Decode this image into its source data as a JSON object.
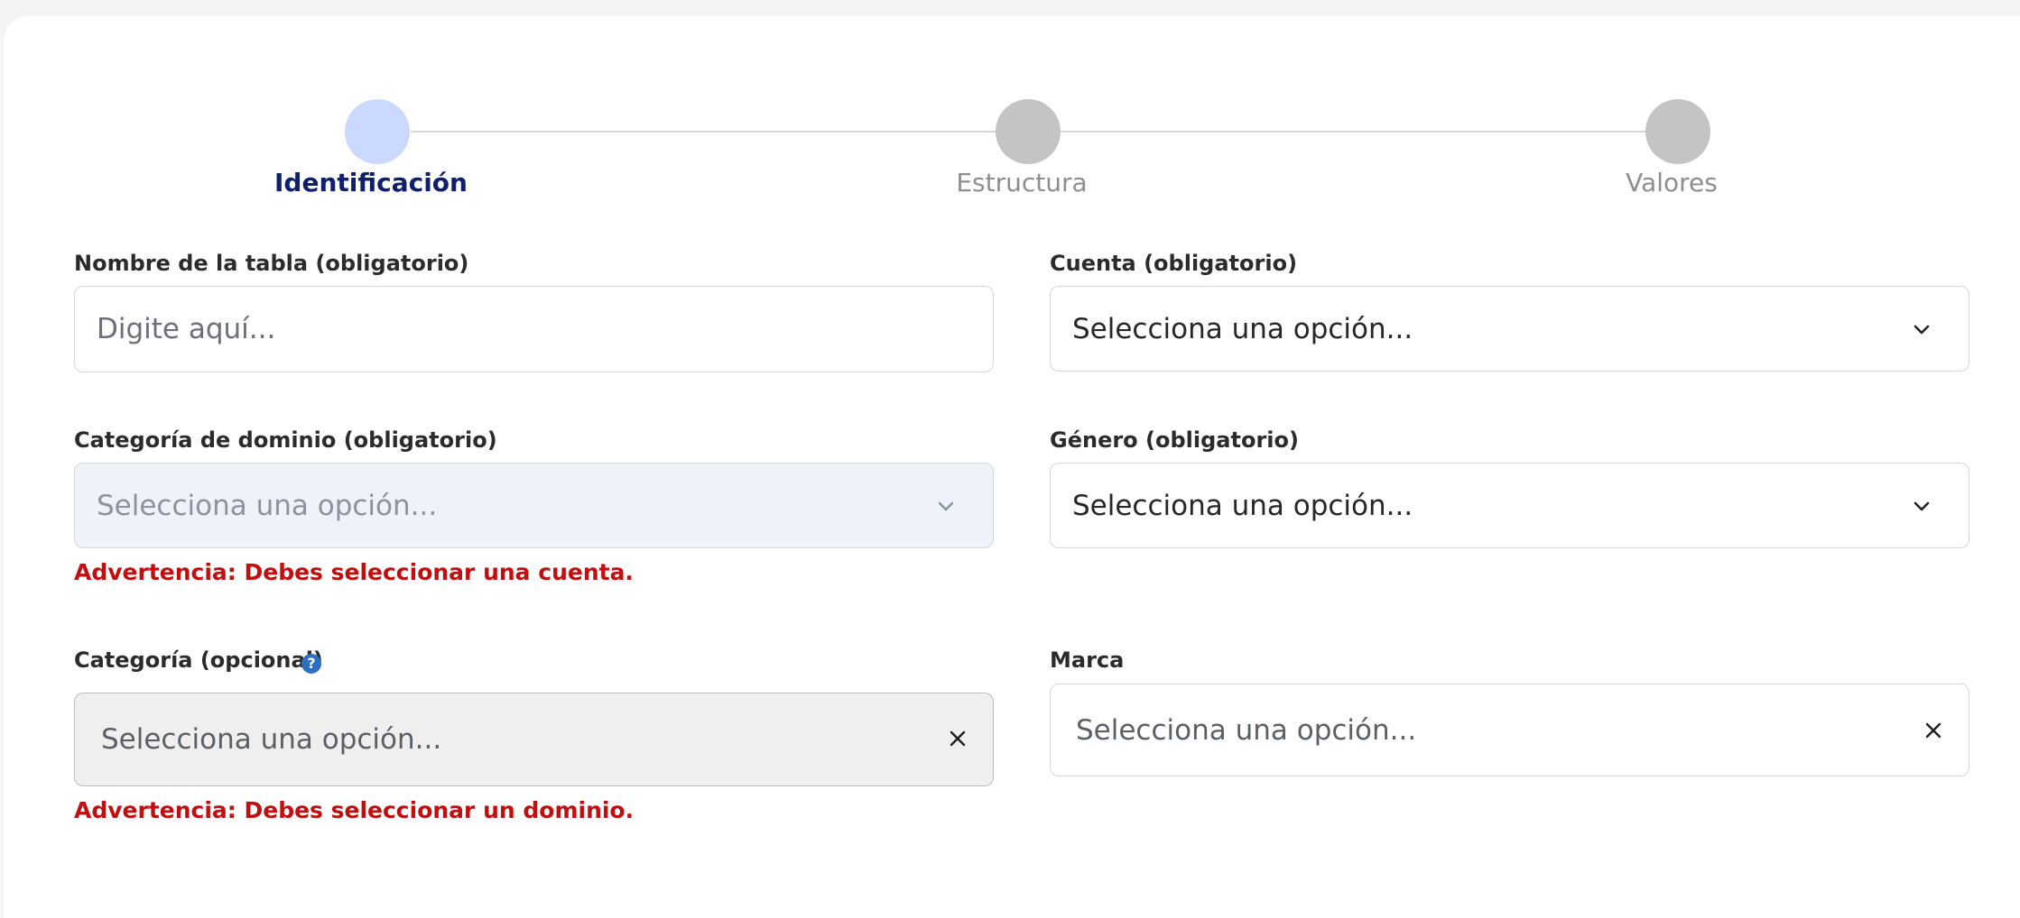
{
  "stepper": {
    "steps": [
      {
        "label": "Identificación",
        "state": "active"
      },
      {
        "label": "Estructura",
        "state": "pending"
      },
      {
        "label": "Valores",
        "state": "pending"
      }
    ],
    "colors": {
      "active_circle": "#ccd9ff",
      "pending_circle": "#c4c4c4",
      "active_label": "#0f1f6b",
      "pending_label": "#8e8e8e"
    }
  },
  "form": {
    "table_name": {
      "label": "Nombre de la tabla (obligatorio)",
      "placeholder": "Digite aquí..."
    },
    "account": {
      "label": "Cuenta (obligatorio)",
      "value": "Selecciona una opción..."
    },
    "domain_category": {
      "label": "Categoría de dominio (obligatorio)",
      "value": "Selecciona una opción...",
      "warning": "Advertencia: Debes seleccionar una cuenta."
    },
    "gender": {
      "label": "Género (obligatorio)",
      "value": "Selecciona una opción..."
    },
    "category": {
      "label": "Categoría (opcional)",
      "help_icon": "question-circle-icon",
      "help_glyph": "?",
      "value": "Selecciona una opción...",
      "warning": "Advertencia: Debes seleccionar un dominio."
    },
    "brand": {
      "label": "Marca",
      "value": "Selecciona una opción..."
    }
  },
  "icons": {
    "dropdown": "chevron-down-icon",
    "clear": "close-icon"
  },
  "colors": {
    "warning": "#c20e0e",
    "help_icon": "#2f6fbf"
  }
}
